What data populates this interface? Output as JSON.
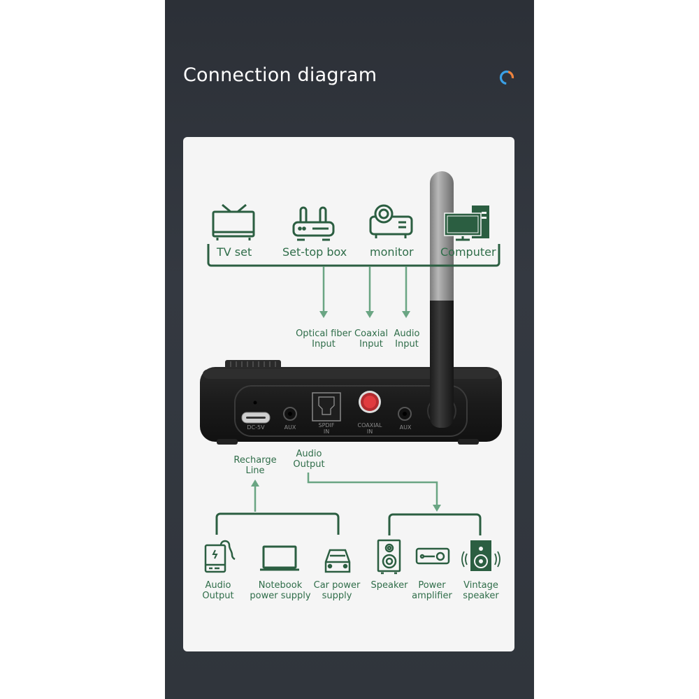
{
  "header": {
    "title": "Connection diagram",
    "logo_icon": "loading-ring-icon"
  },
  "colors": {
    "background_panel": "#31363d",
    "card": "#f5f5f5",
    "dark_green": "#2b5e41",
    "light_green": "#6aa583",
    "title_text": "#ffffff",
    "logo_blue": "#3aa0e6",
    "logo_orange": "#f0813a",
    "coaxial_red": "#e03b3f"
  },
  "input_sources": [
    {
      "label": "TV set",
      "icon": "tv-icon"
    },
    {
      "label": "Set-top box",
      "icon": "router-icon"
    },
    {
      "label": "monitor",
      "icon": "projector-icon"
    },
    {
      "label": "Computer",
      "icon": "computer-icon"
    }
  ],
  "input_types": [
    {
      "label": "Optical fiber\nInput"
    },
    {
      "label": "Coaxial\nInput"
    },
    {
      "label": "Audio\nInput"
    }
  ],
  "device_ports": [
    {
      "label": "DC-5V"
    },
    {
      "label": "AUX"
    },
    {
      "label": "SPDIF\nIN"
    },
    {
      "label": "COAXIAL\nIN"
    },
    {
      "label": "AUX"
    }
  ],
  "connections": {
    "recharge": "Recharge\nLine",
    "audio_output": "Audio\nOutput"
  },
  "power_sources": [
    {
      "label": "Audio\nOutput",
      "icon": "power-bank-icon"
    },
    {
      "label": "Notebook\npower supply",
      "icon": "laptop-icon"
    },
    {
      "label": "Car power\nsupply",
      "icon": "car-icon"
    }
  ],
  "output_devices": [
    {
      "label": "Speaker",
      "icon": "speaker-icon"
    },
    {
      "label": "Power\namplifier",
      "icon": "amplifier-icon"
    },
    {
      "label": "Vintage\nspeaker",
      "icon": "vintage-speaker-icon"
    }
  ]
}
